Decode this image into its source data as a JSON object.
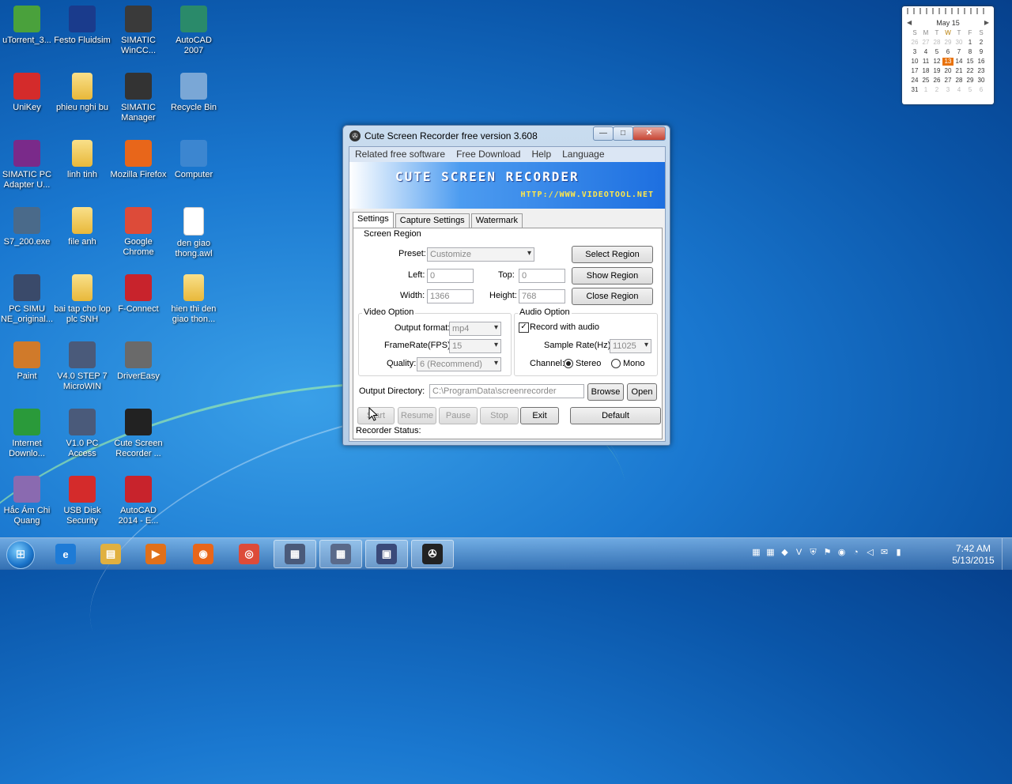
{
  "desktop_icons": [
    {
      "label": "uTorrent_3...",
      "icon": "utorrent-icon",
      "color": "#4aa13c"
    },
    {
      "label": "Festo Fluidsim",
      "icon": "festo-icon",
      "color": "#1a3b8c"
    },
    {
      "label": "SIMATIC WinCC...",
      "icon": "wincc-icon",
      "color": "#3a3a3a"
    },
    {
      "label": "AutoCAD 2007",
      "icon": "autocad-icon",
      "color": "#2a8a6a"
    },
    {
      "label": "UniKey",
      "icon": "unikey-icon",
      "color": "#d42b2b"
    },
    {
      "label": "phieu nghi bu",
      "icon": "folder-icon",
      "color": "#e8b83a"
    },
    {
      "label": "SIMATIC Manager",
      "icon": "simatic-manager-icon",
      "color": "#333333"
    },
    {
      "label": "Recycle Bin",
      "icon": "recycle-bin-icon",
      "color": "#7aa7d6"
    },
    {
      "label": "SIMATIC PC Adapter U...",
      "icon": "winrar-icon",
      "color": "#7a2a8a"
    },
    {
      "label": "linh tinh",
      "icon": "folder-icon",
      "color": "#e8b83a"
    },
    {
      "label": "Mozilla Firefox",
      "icon": "firefox-icon",
      "color": "#e8661a"
    },
    {
      "label": "Computer",
      "icon": "computer-icon",
      "color": "#3c86d0"
    },
    {
      "label": "S7_200.exe",
      "icon": "s7-icon",
      "color": "#4a6a8a"
    },
    {
      "label": "file anh",
      "icon": "folder-icon",
      "color": "#e8b83a"
    },
    {
      "label": "Google Chrome",
      "icon": "chrome-icon",
      "color": "#dd4b39"
    },
    {
      "label": "den giao thong.awl",
      "icon": "file-icon",
      "color": "#ffffff"
    },
    {
      "label": "PC SIMU NE_original...",
      "icon": "pc-simu-icon",
      "color": "#3a4a6a"
    },
    {
      "label": "bai tap cho lop plc SNH",
      "icon": "folder-icon",
      "color": "#e8b83a"
    },
    {
      "label": "F-Connect",
      "icon": "fconnect-icon",
      "color": "#c8232c"
    },
    {
      "label": "hien thi den giao thon...",
      "icon": "folder-icon",
      "color": "#e8b83a"
    },
    {
      "label": "Paint",
      "icon": "paint-icon",
      "color": "#d07a2a"
    },
    {
      "label": "V4.0 STEP 7 MicroWIN",
      "icon": "microwin-icon",
      "color": "#4a5a7a"
    },
    {
      "label": "DriverEasy",
      "icon": "drivereasy-icon",
      "color": "#6a6a6a"
    },
    {
      "label": "",
      "icon": "",
      "color": ""
    },
    {
      "label": "Internet Downlo...",
      "icon": "idm-icon",
      "color": "#2a9a3a"
    },
    {
      "label": "V1.0 PC Access",
      "icon": "pc-access-icon",
      "color": "#4a5a7a"
    },
    {
      "label": "Cute Screen Recorder ...",
      "icon": "film-reel-icon",
      "color": "#222222"
    },
    {
      "label": "",
      "icon": "",
      "color": ""
    },
    {
      "label": "Hắc Ám Chi Quang",
      "icon": "game-icon",
      "color": "#8a6ab0"
    },
    {
      "label": "USB Disk Security",
      "icon": "shield-icon",
      "color": "#d42b2b"
    },
    {
      "label": "AutoCAD 2014 - E...",
      "icon": "autocad-icon",
      "color": "#c8232c"
    }
  ],
  "calendar": {
    "month": "May 15",
    "prev": "◀",
    "next": "▶",
    "weekdays": [
      "S",
      "M",
      "T",
      "W",
      "T",
      "F",
      "S"
    ],
    "days": [
      [
        "26",
        "27",
        "28",
        "29",
        "30",
        "1",
        "2"
      ],
      [
        "3",
        "4",
        "5",
        "6",
        "7",
        "8",
        "9"
      ],
      [
        "10",
        "11",
        "12",
        "13",
        "14",
        "15",
        "16"
      ],
      [
        "17",
        "18",
        "19",
        "20",
        "21",
        "22",
        "23"
      ],
      [
        "24",
        "25",
        "26",
        "27",
        "28",
        "29",
        "30"
      ],
      [
        "31",
        "1",
        "2",
        "3",
        "4",
        "5",
        "6"
      ]
    ],
    "today": "13"
  },
  "window": {
    "title": "Cute Screen Recorder free version 3.608",
    "minimize": "—",
    "maximize": "□",
    "close": "✕",
    "menu": [
      "Related free software",
      "Free Download",
      "Help",
      "Language"
    ],
    "banner_title": "CUTE SCREEN RECORDER",
    "banner_url": "HTTP://WWW.VIDEOTOOL.NET",
    "tabs": [
      "Settings",
      "Capture Settings",
      "Watermark"
    ],
    "screen_region": {
      "title": "Screen Region",
      "preset_label": "Preset:",
      "preset_value": "Customize",
      "left_label": "Left:",
      "left_value": "0",
      "top_label": "Top:",
      "top_value": "0",
      "width_label": "Width:",
      "width_value": "1366",
      "height_label": "Height:",
      "height_value": "768",
      "select_region": "Select Region",
      "show_region": "Show Region",
      "close_region": "Close Region"
    },
    "video_option": {
      "title": "Video Option",
      "format_label": "Output format:",
      "format_value": "mp4",
      "fps_label": "FrameRate(FPS):",
      "fps_value": "15",
      "quality_label": "Quality:",
      "quality_value": "6 (Recommend)"
    },
    "audio_option": {
      "title": "Audio Option",
      "record_audio_label": "Record with audio",
      "record_audio_checked": "✓",
      "sample_rate_label": "Sample Rate(Hz):",
      "sample_rate_value": "11025",
      "channel_label": "Channel:",
      "stereo_label": "Stereo",
      "mono_label": "Mono"
    },
    "output": {
      "label": "Output Directory:",
      "value": "C:\\ProgramData\\screenrecorder",
      "browse": "Browse",
      "open": "Open"
    },
    "controls": {
      "start": "Start",
      "resume": "Resume",
      "pause": "Pause",
      "stop": "Stop",
      "exit": "Exit",
      "default": "Default"
    },
    "status_label": "Recorder Status:"
  },
  "taskbar": {
    "start_glyph": "⊞",
    "items": [
      {
        "icon": "ie-icon",
        "glyph": "e",
        "color": "#1e7bd6"
      },
      {
        "icon": "explorer-icon",
        "glyph": "▤",
        "color": "#e0b040"
      },
      {
        "icon": "media-player-icon",
        "glyph": "▶",
        "color": "#e0701a"
      },
      {
        "icon": "firefox-icon",
        "glyph": "◉",
        "color": "#e8661a"
      },
      {
        "icon": "chrome-icon",
        "glyph": "◎",
        "color": "#dd4b39"
      },
      {
        "icon": "microwin-icon",
        "glyph": "▦",
        "color": "#4a5a7a"
      },
      {
        "icon": "pc-access-icon",
        "glyph": "▦",
        "color": "#5a6a8a"
      },
      {
        "icon": "pc-simu-icon",
        "glyph": "▣",
        "color": "#3a4a7a"
      },
      {
        "icon": "film-reel-icon",
        "glyph": "✇",
        "color": "#222222"
      }
    ],
    "tray_icons": [
      "▦",
      "▦",
      "◆",
      "V",
      "⛨",
      "⚑",
      "◉",
      "◔",
      "◁",
      "✉",
      "▮"
    ],
    "time": "7:42 AM",
    "date": "5/13/2015"
  }
}
